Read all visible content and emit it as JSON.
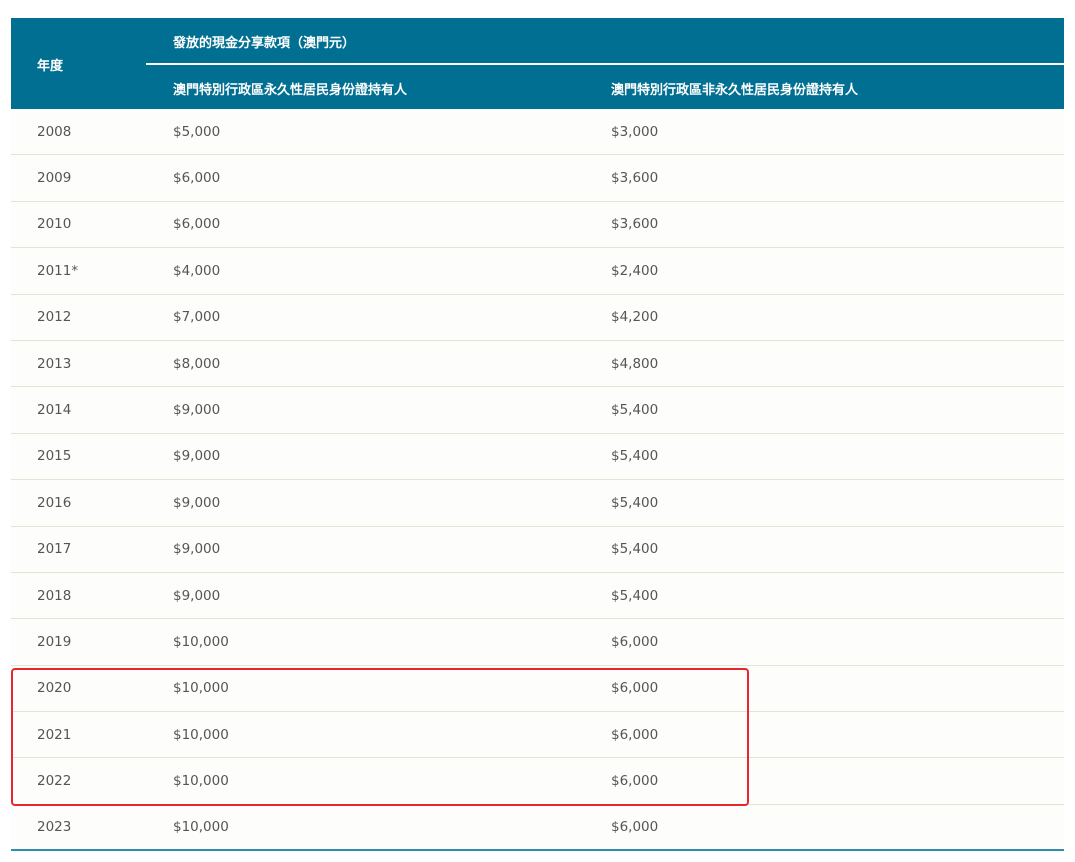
{
  "header": {
    "year_label": "年度",
    "group_label": "發放的現金分享款項（澳門元）",
    "permanent_label": "澳門特別行政區永久性居民身份證持有人",
    "nonpermanent_label": "澳門特別行政區非永久性居民身份證持有人"
  },
  "rows": [
    {
      "year": "2008",
      "permanent": "$5,000",
      "nonpermanent": "$3,000"
    },
    {
      "year": "2009",
      "permanent": "$6,000",
      "nonpermanent": "$3,600"
    },
    {
      "year": "2010",
      "permanent": "$6,000",
      "nonpermanent": "$3,600"
    },
    {
      "year": "2011*",
      "permanent": "$4,000",
      "nonpermanent": "$2,400"
    },
    {
      "year": "2012",
      "permanent": "$7,000",
      "nonpermanent": "$4,200"
    },
    {
      "year": "2013",
      "permanent": "$8,000",
      "nonpermanent": "$4,800"
    },
    {
      "year": "2014",
      "permanent": "$9,000",
      "nonpermanent": "$5,400"
    },
    {
      "year": "2015",
      "permanent": "$9,000",
      "nonpermanent": "$5,400"
    },
    {
      "year": "2016",
      "permanent": "$9,000",
      "nonpermanent": "$5,400"
    },
    {
      "year": "2017",
      "permanent": "$9,000",
      "nonpermanent": "$5,400"
    },
    {
      "year": "2018",
      "permanent": "$9,000",
      "nonpermanent": "$5,400"
    },
    {
      "year": "2019",
      "permanent": "$10,000",
      "nonpermanent": "$6,000"
    },
    {
      "year": "2020",
      "permanent": "$10,000",
      "nonpermanent": "$6,000"
    },
    {
      "year": "2021",
      "permanent": "$10,000",
      "nonpermanent": "$6,000"
    },
    {
      "year": "2022",
      "permanent": "$10,000",
      "nonpermanent": "$6,000"
    },
    {
      "year": "2023",
      "permanent": "$10,000",
      "nonpermanent": "$6,000"
    }
  ],
  "colors": {
    "header_bg": "#006f91",
    "highlight_border": "#e8262d",
    "row_divider": "#e7e3d3"
  }
}
